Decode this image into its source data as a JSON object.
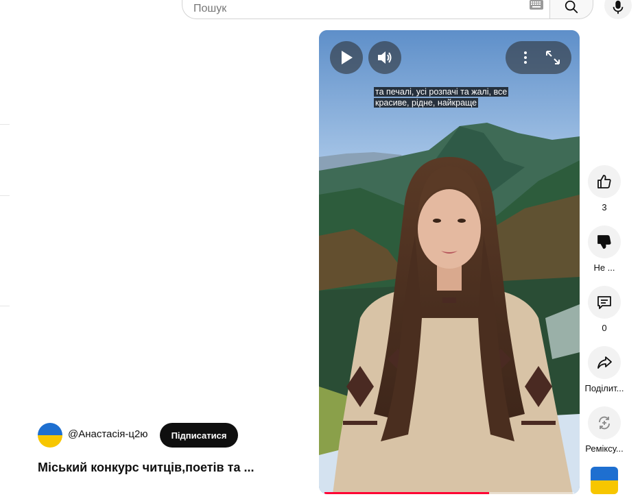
{
  "search": {
    "placeholder": "Пошук"
  },
  "caption": {
    "line1": "та печалі, усі розпачі та жалі, все",
    "line2": "красиве, рідне, найкраще"
  },
  "player": {
    "progress": 0.66
  },
  "channel": {
    "handle": "@Анастасія-ц2ю",
    "subscribe_label": "Підписатися"
  },
  "video": {
    "title": "Міський конкурс читців,поетів та ..."
  },
  "actions": {
    "like_count": "3",
    "dislike_label": "Не ...",
    "comments_count": "0",
    "share_label": "Поділит...",
    "remix_label": "Реміксу..."
  },
  "colors": {
    "accent": "#ff0033",
    "subscribe_bg": "#0f0f0f",
    "flag_blue": "#1e6fd0",
    "flag_yellow": "#f7c600"
  }
}
